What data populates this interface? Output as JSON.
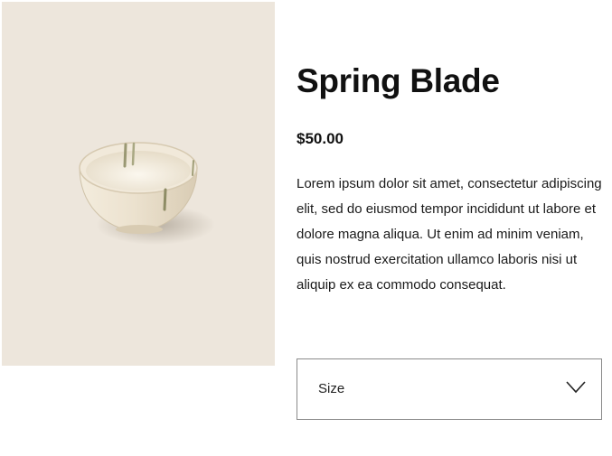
{
  "product": {
    "title": "Spring Blade",
    "price": "$50.00",
    "description": "Lorem ipsum dolor sit amet, consectetur adipiscing elit, sed do eiusmod tempor incididunt ut labore et dolore magna aliqua. Ut enim ad minim veniam, quis nostrud exercitation ullamco laboris nisi ut aliquip ex ea commodo consequat.",
    "image": {
      "icon": "ceramic-bowl-photo",
      "background_color": "#ede6dc"
    }
  },
  "size_select": {
    "label": "Size",
    "icon": "chevron-down-icon"
  }
}
